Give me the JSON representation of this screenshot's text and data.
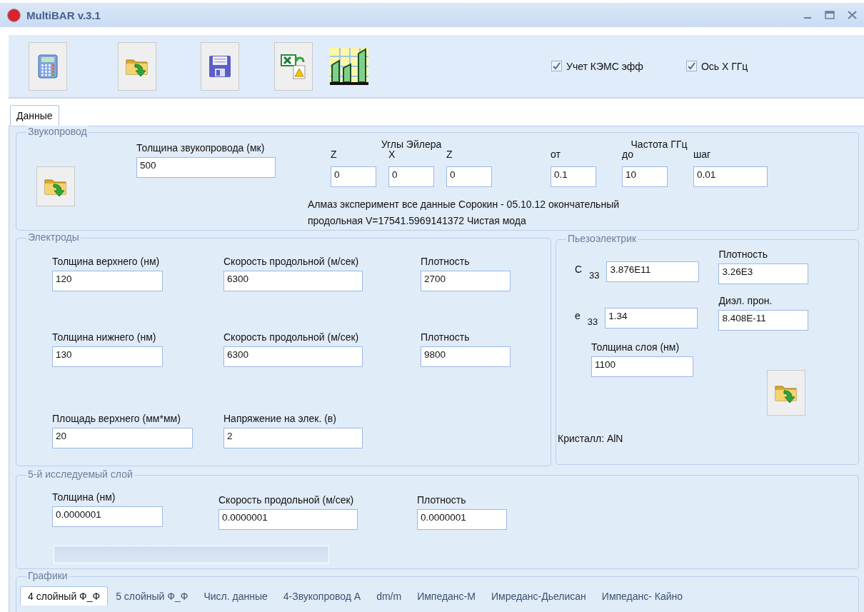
{
  "window": {
    "title": "MultiBAR v.3.1"
  },
  "toolbar": {
    "buttons": [
      {
        "kind": "calculator"
      },
      {
        "kind": "open"
      },
      {
        "kind": "save"
      },
      {
        "kind": "export"
      },
      {
        "kind": "chart"
      }
    ],
    "options": [
      {
        "label": "Учет КЭМС эфф",
        "checked": true
      },
      {
        "label": "Ось X ГГц",
        "checked": true
      }
    ]
  },
  "tabs": [
    {
      "label": "Данные",
      "selected": true
    }
  ],
  "waveguide": {
    "title": "Звукопровод",
    "thickness": {
      "label": "Толщина звукопровода (мк)",
      "value": "500"
    },
    "euler": {
      "title": "Углы Эйлера",
      "fields": [
        {
          "label": "Z",
          "value": "0"
        },
        {
          "label": "X",
          "value": "0"
        },
        {
          "label": "Z",
          "value": "0"
        }
      ]
    },
    "frequency": {
      "title": "Частота ГГц",
      "fields": [
        {
          "label": "от",
          "value": "0.1"
        },
        {
          "label": "до",
          "value": "10"
        },
        {
          "label": "шаг",
          "value": "0.01"
        }
      ]
    },
    "description": [
      "Алмаз эксперимент все данные Сорокин - 05.10.12 окончательный",
      "продольная V=17541.5969141372 Чистая мода"
    ]
  },
  "electrodes": {
    "title": "Электроды",
    "rows": [
      [
        {
          "label": "Толщина верхнего (нм)",
          "value": "120"
        },
        {
          "label": "Скорость продольной (м/сек)",
          "value": "6300"
        },
        {
          "label": "Плотность",
          "value": "2700"
        }
      ],
      [
        {
          "label": "Толщина нижнего (нм)",
          "value": "130"
        },
        {
          "label": "Скорость продольной (м/сек)",
          "value": "6300"
        },
        {
          "label": "Плотность",
          "value": "9800"
        }
      ],
      [
        {
          "label": "Площадь верхнего (мм*мм)",
          "value": "20"
        },
        {
          "label": "Напряжение на элек. (в)",
          "value": "2"
        }
      ]
    ]
  },
  "piezo": {
    "title": "Пьезоэлектрик",
    "c33": {
      "label": "C $_{33}$",
      "value": "3.876E11"
    },
    "e33": {
      "label": "e $_{33}$",
      "value": "1.34"
    },
    "density": {
      "label": "Плотность",
      "value": "3.26E3"
    },
    "permittivity": {
      "label": "Диэл. прон.",
      "value": "8.408E-11"
    },
    "layer_thickness": {
      "label": "Толщина слоя (нм)",
      "value": "1100"
    },
    "crystal": "Кристалл: AlN"
  },
  "layer5": {
    "title": "5-й исследуемый слой",
    "fields": [
      {
        "label": "Толщина  (нм)",
        "value": "0.0000001"
      },
      {
        "label": "Скорость продольной (м/сек)",
        "value": "0.0000001"
      },
      {
        "label": "Плотность",
        "value": "0.0000001"
      }
    ],
    "progress": {
      "level": 0
    }
  },
  "charts": {
    "title": "Графики",
    "tabs": [
      {
        "label": "4 слойный Ф_Ф",
        "selected": true
      },
      {
        "label": "5 слойный Ф_Ф",
        "selected": false
      },
      {
        "label": "Числ. данные",
        "selected": false
      },
      {
        "label": "4-Звукопровод А",
        "selected": false
      },
      {
        "label": "dm/m",
        "selected": false
      },
      {
        "label": "Импеданс-М",
        "selected": false
      },
      {
        "label": "Имреданс-Дьелисан",
        "selected": false
      },
      {
        "label": "Импеданс- Кайно",
        "selected": false
      }
    ]
  }
}
